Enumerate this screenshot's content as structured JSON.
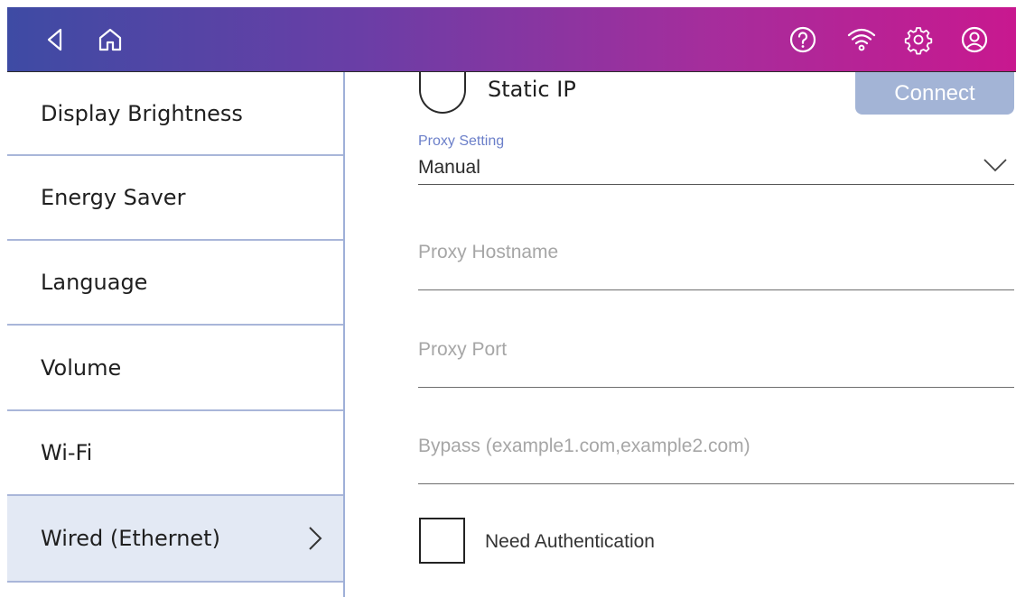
{
  "header": {
    "icons": [
      "back-icon",
      "home-icon",
      "help-icon",
      "wifi-icon",
      "settings-icon",
      "account-icon"
    ],
    "gradient": [
      "#3e4ba4",
      "#c8188f"
    ]
  },
  "sidebar": {
    "items": [
      {
        "label": "Display Brightness"
      },
      {
        "label": "Energy Saver"
      },
      {
        "label": "Language"
      },
      {
        "label": "Volume"
      },
      {
        "label": "Wi-Fi"
      },
      {
        "label": "Wired (Ethernet)",
        "selected": true
      }
    ]
  },
  "main": {
    "static_ip_label": "Static IP",
    "connect_label": "Connect",
    "proxy_setting": {
      "caption": "Proxy Setting",
      "value": "Manual"
    },
    "proxy_hostname": {
      "placeholder": "Proxy Hostname"
    },
    "proxy_port": {
      "placeholder": "Proxy Port"
    },
    "bypass": {
      "placeholder": "Bypass (example1.com,example2.com)"
    },
    "need_auth_label": "Need Authentication"
  },
  "colors": {
    "accent": "#6b7fc9",
    "connect_button": "#a3b4d6",
    "selected_row": "#e3e9f4"
  }
}
